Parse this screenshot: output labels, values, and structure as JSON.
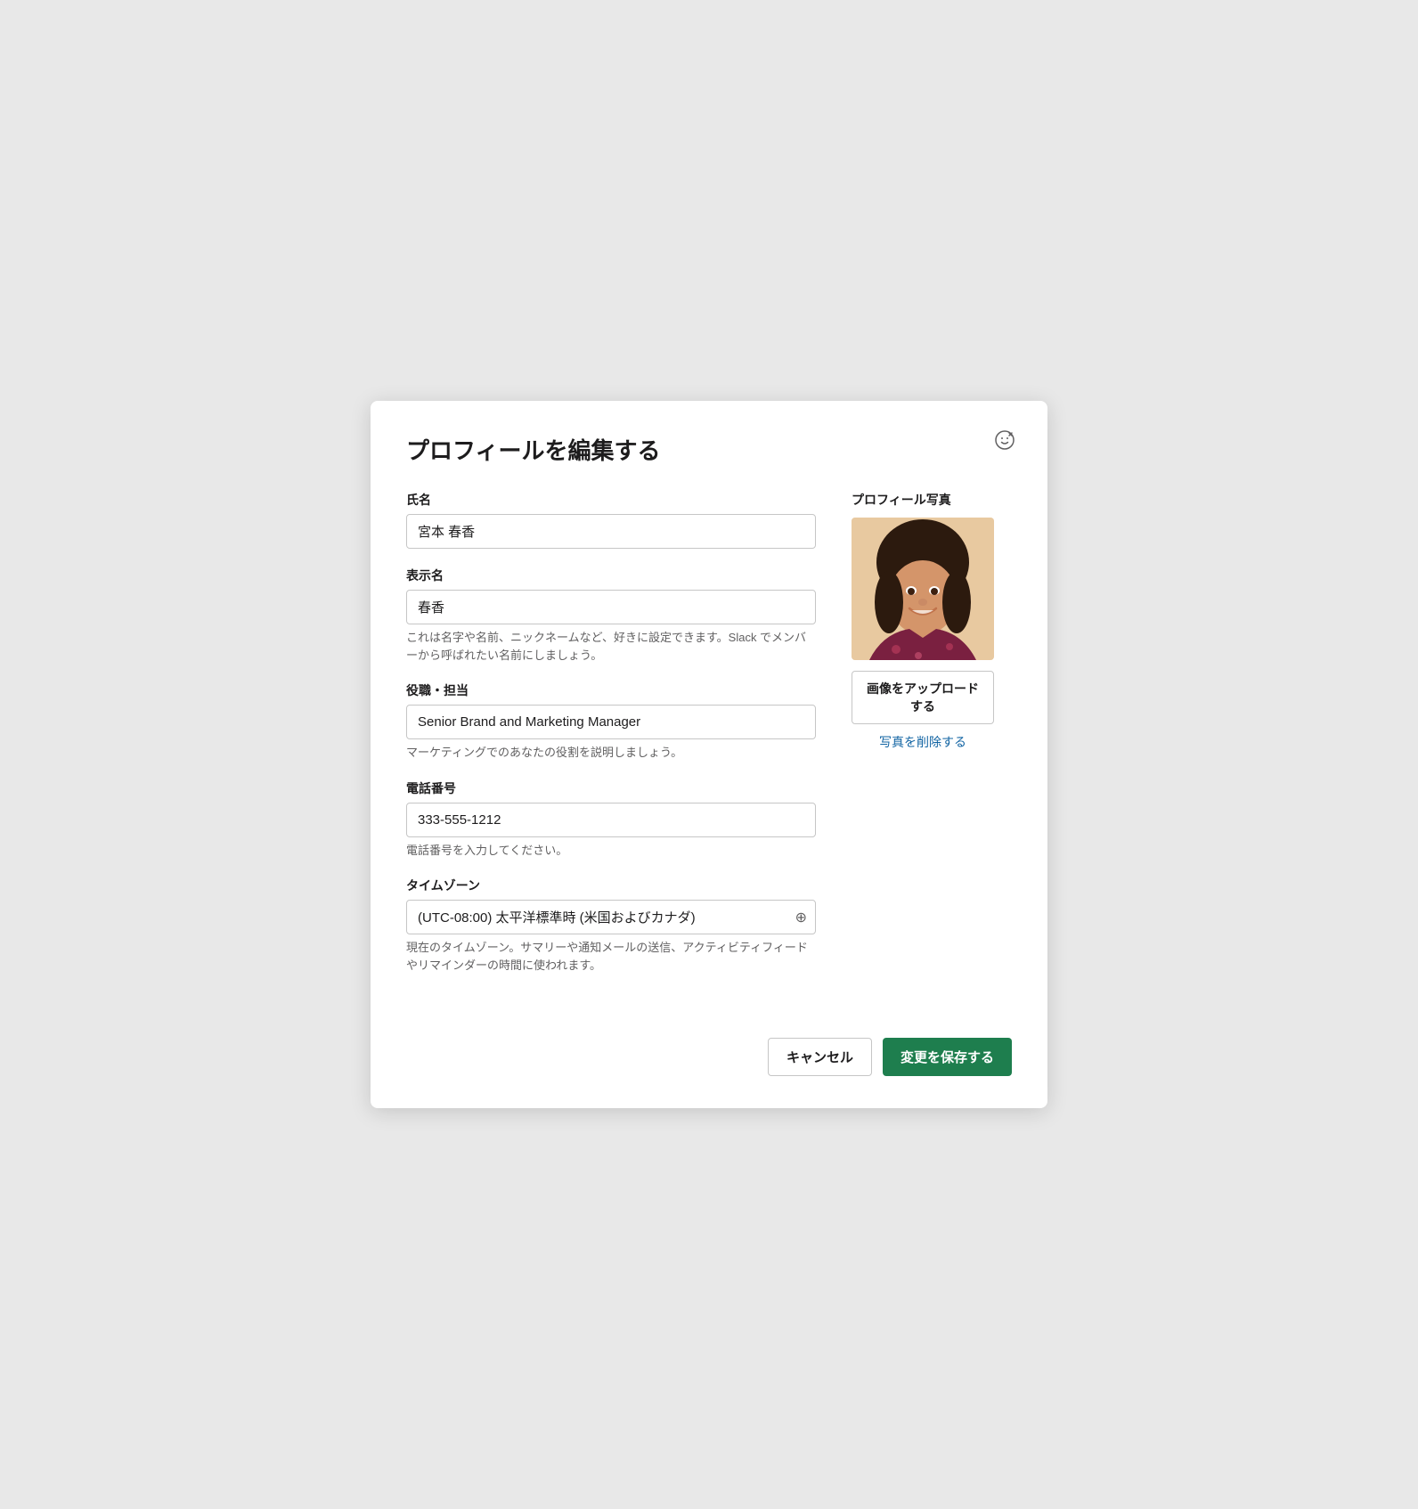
{
  "page": {
    "title": "プロフィールを編集する",
    "emoji_icon": "😊"
  },
  "fields": {
    "full_name": {
      "label": "氏名",
      "value": "宮本 春香",
      "placeholder": ""
    },
    "display_name": {
      "label": "表示名",
      "value": "春香",
      "placeholder": "",
      "hint": "これは名字や名前、ニックネームなど、好きに設定できます。Slack でメンバーから呼ばれたい名前にしましょう。"
    },
    "role": {
      "label": "役職・担当",
      "value": "Senior Brand and Marketing Manager",
      "placeholder": "",
      "hint": "マーケティングでのあなたの役割を説明しましょう。"
    },
    "phone": {
      "label": "電話番号",
      "value": "333-555-1212",
      "placeholder": "",
      "hint": "電話番号を入力してください。"
    },
    "timezone": {
      "label": "タイムゾーン",
      "value": "(UTC-08:00) 太平洋標準時 (米国およびカナダ)",
      "placeholder": "",
      "hint": "現在のタイムゾーン。サマリーや通知メールの送信、アクティビティフィードやリマインダーの時間に使われます。"
    }
  },
  "profile_photo": {
    "label": "プロフィール写真",
    "upload_button": "画像をアップロードする",
    "delete_link": "写真を削除する"
  },
  "footer": {
    "cancel_label": "キャンセル",
    "save_label": "変更を保存する"
  }
}
